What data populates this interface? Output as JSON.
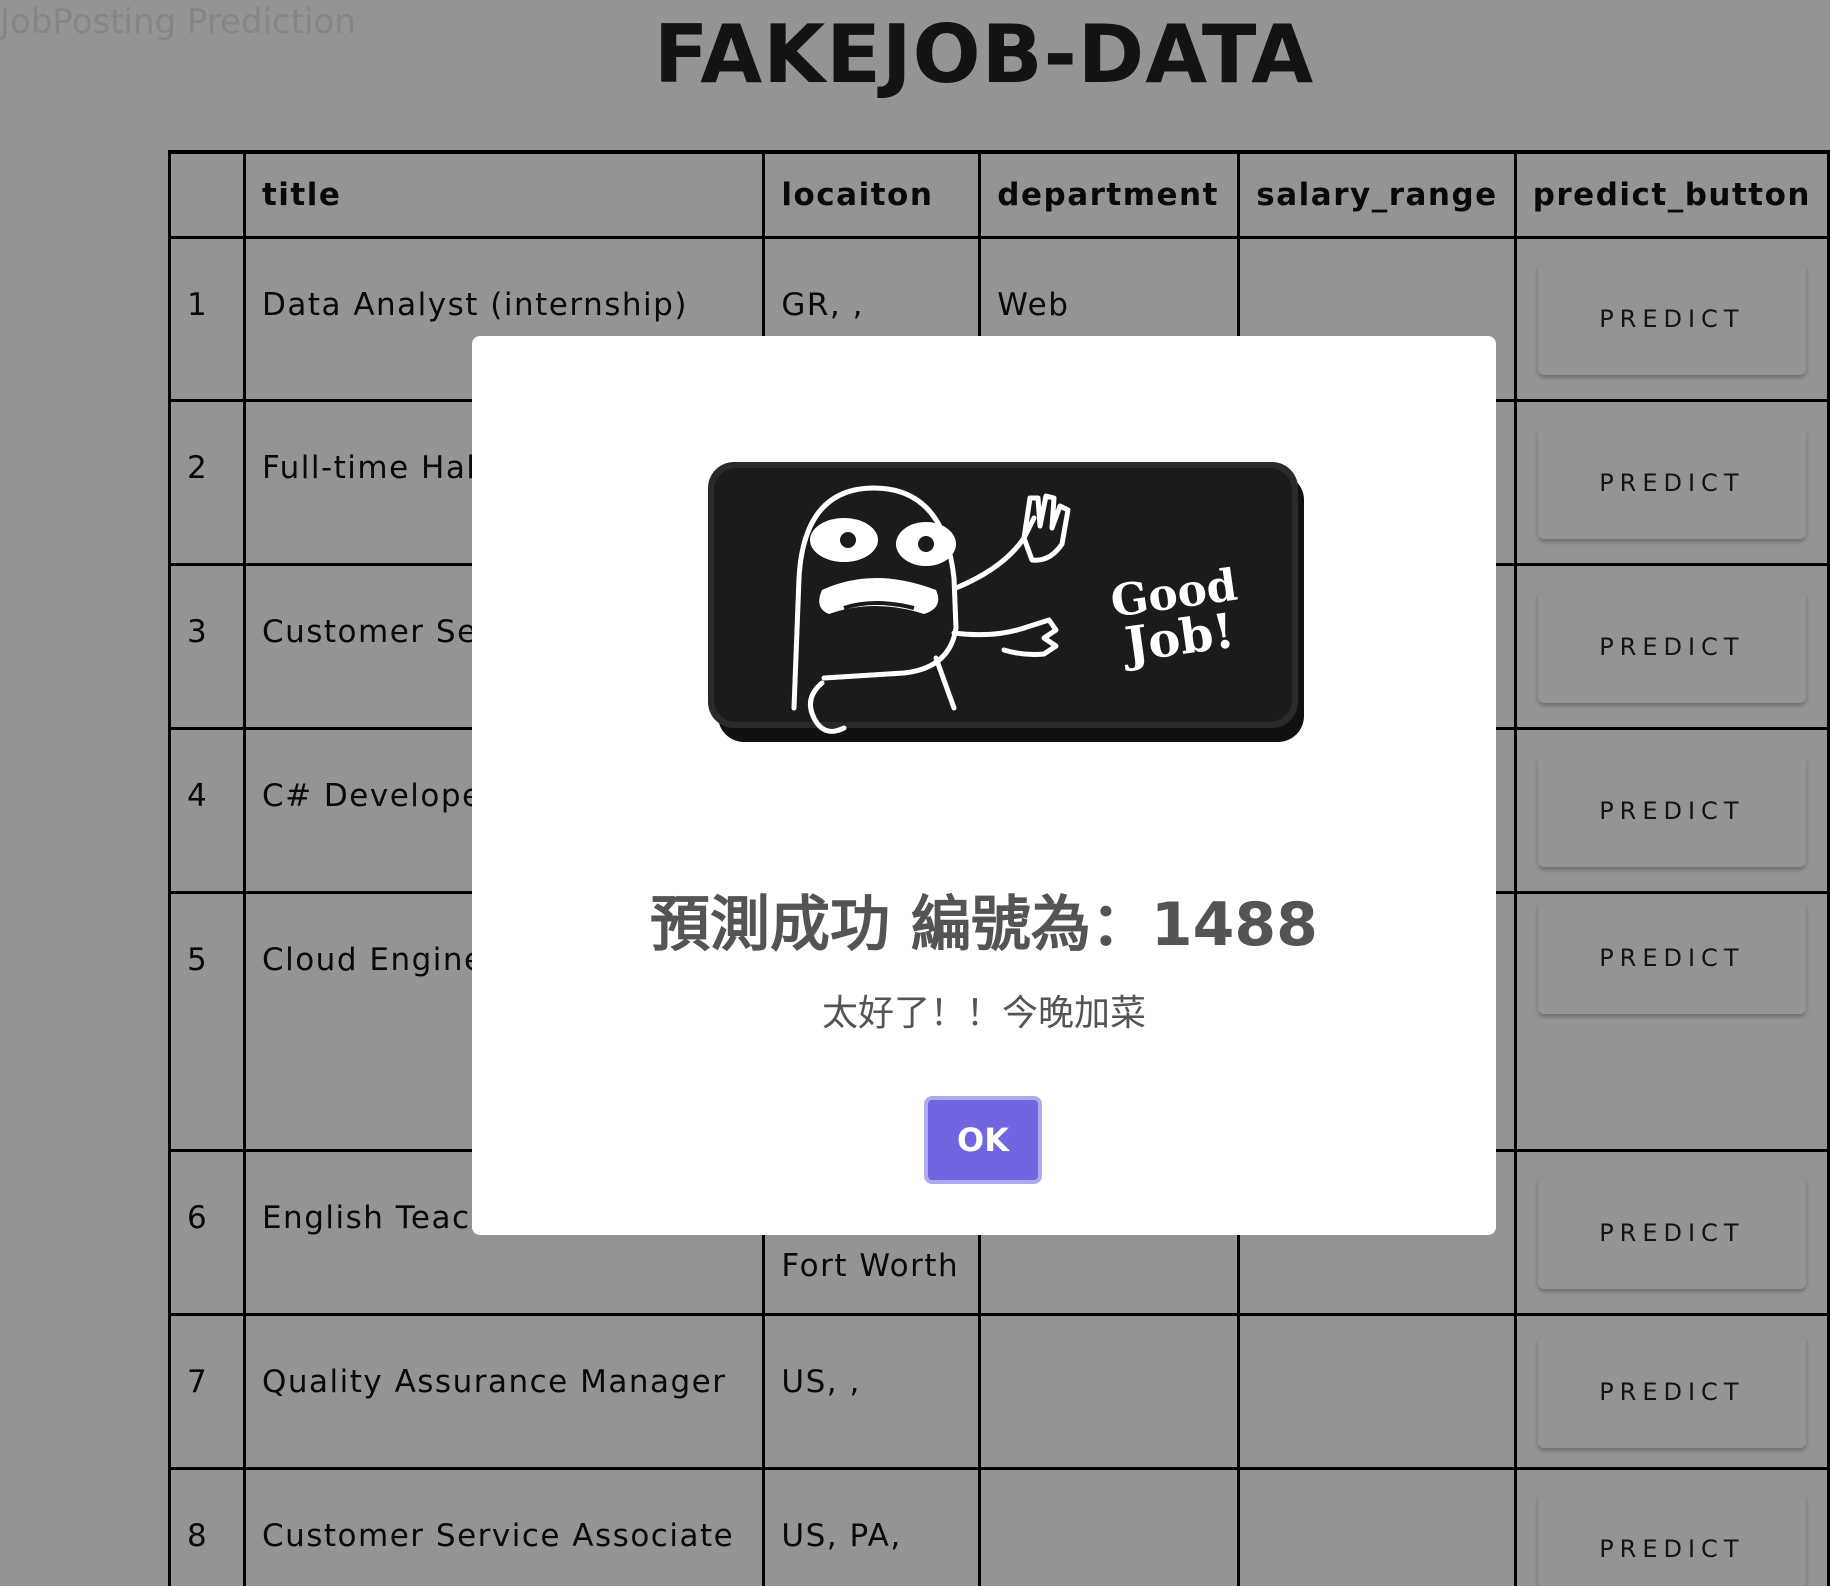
{
  "page": {
    "bg_text": "JobPosting Prediction",
    "title": "FAKEJOB-DATA"
  },
  "table": {
    "headers": [
      "",
      "title",
      "locaiton",
      "department",
      "salary_range",
      "predict_button"
    ],
    "rows": [
      {
        "num": "1",
        "title": "Data Analyst (internship)",
        "location": "GR, ,",
        "department": "Web",
        "salary_range": "",
        "button": "PREDICT"
      },
      {
        "num": "2",
        "title": "Full-time Hab Specialist/Dir",
        "location": "",
        "department": "",
        "salary_range": "",
        "button": "PREDICT"
      },
      {
        "num": "3",
        "title": "Customer Se",
        "location": "",
        "department": "",
        "salary_range": "",
        "button": "PREDICT"
      },
      {
        "num": "4",
        "title": "C# Developer",
        "location": "",
        "department": "",
        "salary_range": "",
        "button": "PREDICT"
      },
      {
        "num": "5",
        "title": "Cloud Engineer/Dev",
        "location": "",
        "department": "",
        "salary_range": "",
        "button": "PREDICT"
      },
      {
        "num": "6",
        "title": "English Teach",
        "location": "Fort Worth",
        "department": "",
        "salary_range": "",
        "button": "PREDICT"
      },
      {
        "num": "7",
        "title": "Quality Assurance Manager",
        "location": "US, ,",
        "department": "",
        "salary_range": "",
        "button": "PREDICT"
      },
      {
        "num": "8",
        "title": "Customer Service Associate",
        "location": "US, PA,",
        "department": "",
        "salary_range": "",
        "button": "PREDICT"
      }
    ]
  },
  "dialog": {
    "image_icon": "good-job-badge",
    "badge_text_line1": "Good",
    "badge_text_line2": "Job!",
    "title": "預測成功 編號為：1488",
    "text": "太好了！！今晚加菜",
    "ok_label": "OK",
    "ok_color": "#7066e0"
  }
}
